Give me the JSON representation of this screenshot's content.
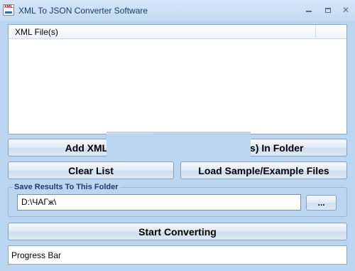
{
  "window": {
    "title": "XML To JSON Converter Software",
    "icon_text": "XML"
  },
  "file_list": {
    "column_header": "XML File(s)"
  },
  "buttons": {
    "add_files_label": "Add XML F",
    "add_folder_label": ". File(s) In Folder",
    "clear_list_label": "Clear List",
    "load_sample_label": "Load Sample/Example Files",
    "browse_label": "...",
    "start_converting_label": "Start Converting"
  },
  "save_results": {
    "group_label": "Save Results To This Folder",
    "path_value": "D:\\ЧАГж\\"
  },
  "progress": {
    "label": "Progress Bar"
  },
  "colors": {
    "window_background": "#bcd6f2",
    "title_text": "#1e395b",
    "group_label_text": "#1a3d6b"
  }
}
